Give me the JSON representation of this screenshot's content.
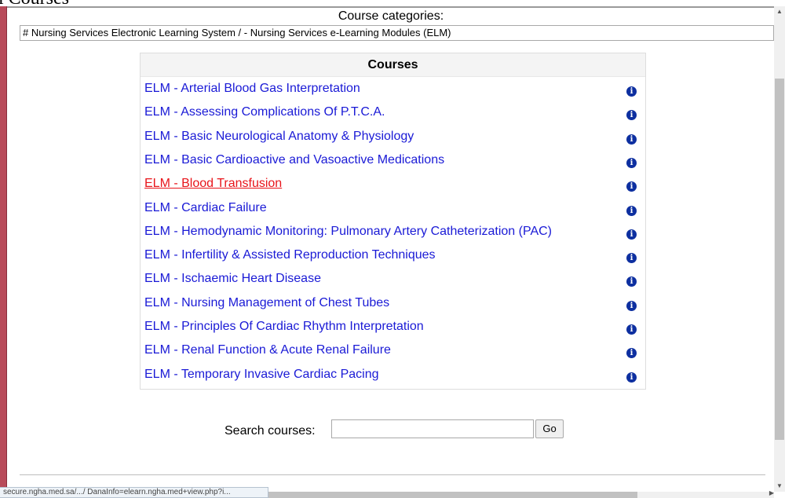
{
  "page": {
    "heading": "l Courses"
  },
  "categories": {
    "label": "Course categories:",
    "selected": "# Nursing Services Electronic Learning System / - Nursing Services e-Learning Modules (ELM)"
  },
  "courses": {
    "header": "Courses",
    "items": [
      {
        "label": "ELM - Arterial Blood Gas Interpretation"
      },
      {
        "label": "ELM - Assessing Complications Of P.T.C.A."
      },
      {
        "label": "ELM - Basic Neurological Anatomy & Physiology"
      },
      {
        "label": "ELM - Basic Cardioactive and Vasoactive Medications"
      },
      {
        "label": "ELM - Blood Transfusion",
        "active": true
      },
      {
        "label": "ELM - Cardiac Failure"
      },
      {
        "label": "ELM - Hemodynamic Monitoring: Pulmonary Artery Catheterization (PAC)"
      },
      {
        "label": "ELM - Infertility & Assisted Reproduction Techniques"
      },
      {
        "label": "ELM - Ischaemic Heart Disease"
      },
      {
        "label": "ELM - Nursing Management of Chest Tubes"
      },
      {
        "label": "ELM - Principles Of Cardiac Rhythm Interpretation"
      },
      {
        "label": "ELM - Renal Function & Acute Renal Failure"
      },
      {
        "label": "ELM - Temporary Invasive Cardiac Pacing"
      }
    ],
    "info_icon": "info-icon"
  },
  "search": {
    "label": "Search courses:",
    "value": "",
    "button": "Go"
  },
  "status_bar": {
    "text": "secure.ngha.med.sa/.../ DanaInfo=elearn.ngha.med+view.php?i..."
  },
  "colors": {
    "link": "#1a1ad6",
    "link_active": "#e8141a",
    "frame_bar": "#b84b5a",
    "info_icon": "#0d2fa0"
  }
}
